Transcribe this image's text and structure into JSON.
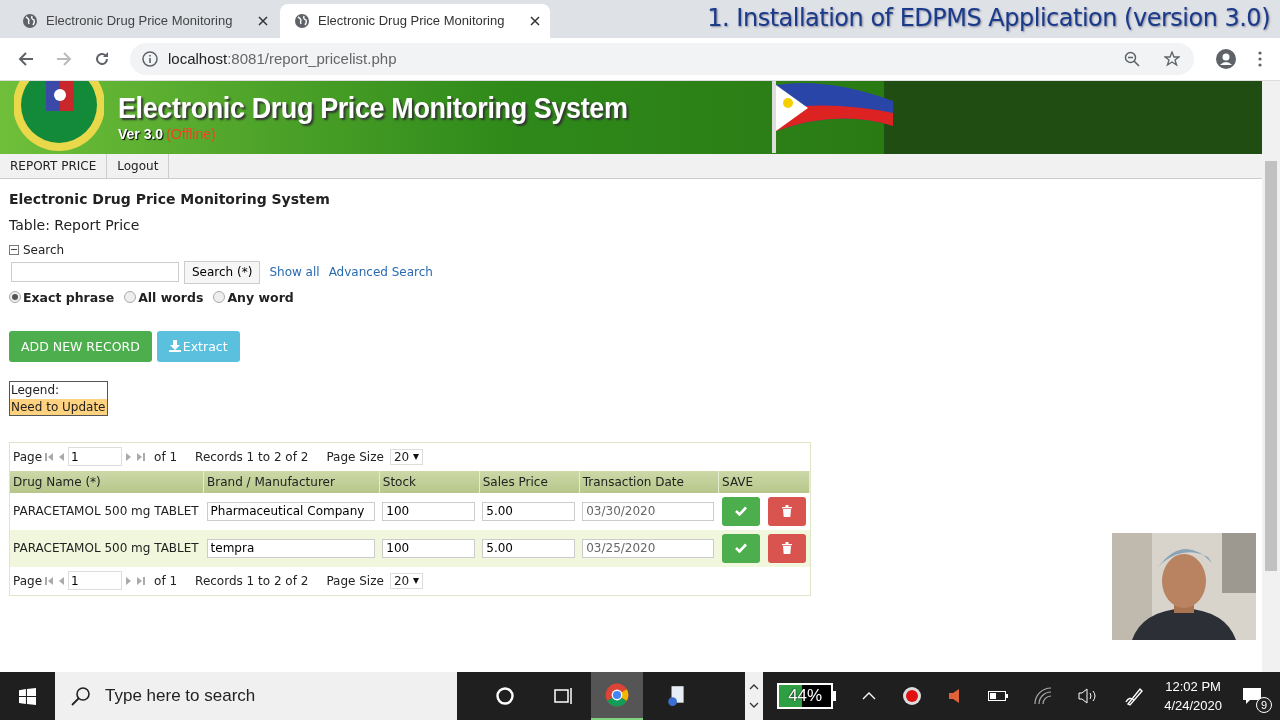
{
  "browser": {
    "tabs": [
      {
        "title": "Electronic Drug Price Monitoring",
        "selected": false
      },
      {
        "title": "Electronic Drug Price Monitoring",
        "selected": true
      }
    ],
    "url_host": "localhost",
    "url_path": ":8081/report_pricelist.php"
  },
  "caption": "1. Installation of EDPMS Application (version 3.0)",
  "banner": {
    "title": "Electronic Drug Price Monitoring System",
    "version": "Ver 3.0",
    "status": "(Offline)"
  },
  "nav": [
    "REPORT PRICE",
    "Logout"
  ],
  "page": {
    "heading": "Electronic Drug Price Monitoring System",
    "subheading": "Table: Report Price"
  },
  "search": {
    "label": "Search",
    "expanded": true,
    "button": "Search (*)",
    "links": [
      "Show all",
      "Advanced Search"
    ],
    "modes": [
      {
        "label": "Exact phrase",
        "selected": true
      },
      {
        "label": "All words",
        "selected": false
      },
      {
        "label": "Any word",
        "selected": false
      }
    ]
  },
  "actions": [
    {
      "kind": "add",
      "label": "ADD NEW RECORD"
    },
    {
      "kind": "extract",
      "label": "Extract"
    }
  ],
  "legend": {
    "title": "Legend:",
    "items": [
      {
        "label": "Need to Update",
        "color": "#ffd27f"
      }
    ]
  },
  "pagers": [
    {
      "page_label": "Page",
      "page": "1",
      "of": "of 1",
      "records": "Records 1 to 2 of 2",
      "size_label": "Page Size",
      "size": "20"
    },
    {
      "page_label": "Page",
      "page": "1",
      "of": "of 1",
      "records": "Records 1 to 2 of 2",
      "size_label": "Page Size",
      "size": "20"
    }
  ],
  "table": {
    "columns": [
      "Drug Name (*)",
      "Brand / Manufacturer",
      "Stock",
      "Sales Price",
      "Transaction Date",
      "SAVE"
    ],
    "rows": [
      {
        "drug": "PARACETAMOL 500 mg TABLET",
        "brand": "Pharmaceutical Company",
        "stock": "100",
        "price": "5.00",
        "date": "03/30/2020"
      },
      {
        "drug": "PARACETAMOL 500 mg TABLET",
        "brand": "tempra",
        "stock": "100",
        "price": "5.00",
        "date": "03/25/2020"
      }
    ]
  },
  "taskbar": {
    "search_placeholder": "Type here to search",
    "battery": {
      "reading": "44%",
      "level": 0.44
    },
    "time": "12:02 PM",
    "date": "4/24/2020",
    "notifications": "9"
  }
}
